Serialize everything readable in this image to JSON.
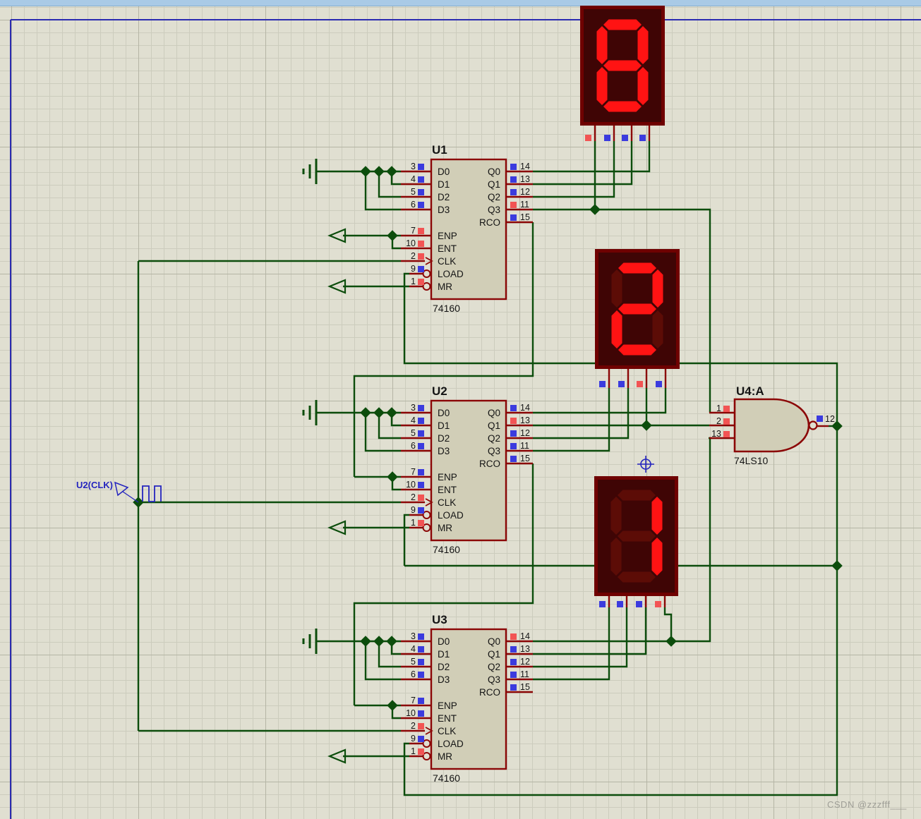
{
  "window": {
    "watermark": "CSDN @zzzfff___"
  },
  "colors": {
    "wire": "#0C4D0C",
    "pin": "#8B0606",
    "chip_fill": "#D1CEB7",
    "chip_border": "#8B0606",
    "state_red": "#F25454",
    "state_blue": "#3B3BDE",
    "ink_blue": "#2525BE",
    "display_bg": "#3F0505",
    "display_border": "#6F0101",
    "segment_lit": "#FF1313",
    "segment_unlit": "#5C0C06",
    "text": "#141414",
    "sheet_border": "#2B2BB0"
  },
  "clock_source": {
    "label": "U2(CLK)"
  },
  "chips": [
    {
      "ref": "U1",
      "part": "74160",
      "left_pins": [
        {
          "num": "3",
          "label": "D0",
          "state": "blue"
        },
        {
          "num": "4",
          "label": "D1",
          "state": "blue"
        },
        {
          "num": "5",
          "label": "D2",
          "state": "blue"
        },
        {
          "num": "6",
          "label": "D3",
          "state": "blue"
        },
        {
          "num": "7",
          "label": "ENP",
          "state": "red"
        },
        {
          "num": "10",
          "label": "ENT",
          "state": "red"
        },
        {
          "num": "2",
          "label": "CLK",
          "state": "red",
          "clock": true
        },
        {
          "num": "9",
          "label": "LOAD",
          "state": "blue",
          "bubble": true
        },
        {
          "num": "1",
          "label": "MR",
          "state": "red",
          "bubble": true
        }
      ],
      "right_pins": [
        {
          "num": "14",
          "label": "Q0",
          "state": "blue"
        },
        {
          "num": "13",
          "label": "Q1",
          "state": "blue"
        },
        {
          "num": "12",
          "label": "Q2",
          "state": "blue"
        },
        {
          "num": "11",
          "label": "Q3",
          "state": "red"
        },
        {
          "num": "15",
          "label": "RCO",
          "state": "blue"
        }
      ]
    },
    {
      "ref": "U2",
      "part": "74160",
      "left_pins": [
        {
          "num": "3",
          "label": "D0",
          "state": "blue"
        },
        {
          "num": "4",
          "label": "D1",
          "state": "blue"
        },
        {
          "num": "5",
          "label": "D2",
          "state": "blue"
        },
        {
          "num": "6",
          "label": "D3",
          "state": "blue"
        },
        {
          "num": "7",
          "label": "ENP",
          "state": "blue"
        },
        {
          "num": "10",
          "label": "ENT",
          "state": "blue"
        },
        {
          "num": "2",
          "label": "CLK",
          "state": "red",
          "clock": true
        },
        {
          "num": "9",
          "label": "LOAD",
          "state": "blue",
          "bubble": true
        },
        {
          "num": "1",
          "label": "MR",
          "state": "red",
          "bubble": true
        }
      ],
      "right_pins": [
        {
          "num": "14",
          "label": "Q0",
          "state": "blue"
        },
        {
          "num": "13",
          "label": "Q1",
          "state": "red"
        },
        {
          "num": "12",
          "label": "Q2",
          "state": "blue"
        },
        {
          "num": "11",
          "label": "Q3",
          "state": "blue"
        },
        {
          "num": "15",
          "label": "RCO",
          "state": "blue"
        }
      ]
    },
    {
      "ref": "U3",
      "part": "74160",
      "left_pins": [
        {
          "num": "3",
          "label": "D0",
          "state": "blue"
        },
        {
          "num": "4",
          "label": "D1",
          "state": "blue"
        },
        {
          "num": "5",
          "label": "D2",
          "state": "blue"
        },
        {
          "num": "6",
          "label": "D3",
          "state": "blue"
        },
        {
          "num": "7",
          "label": "ENP",
          "state": "blue"
        },
        {
          "num": "10",
          "label": "ENT",
          "state": "blue"
        },
        {
          "num": "2",
          "label": "CLK",
          "state": "red",
          "clock": true
        },
        {
          "num": "9",
          "label": "LOAD",
          "state": "blue",
          "bubble": true
        },
        {
          "num": "1",
          "label": "MR",
          "state": "red",
          "bubble": true
        }
      ],
      "right_pins": [
        {
          "num": "14",
          "label": "Q0",
          "state": "red"
        },
        {
          "num": "13",
          "label": "Q1",
          "state": "blue"
        },
        {
          "num": "12",
          "label": "Q2",
          "state": "blue"
        },
        {
          "num": "11",
          "label": "Q3",
          "state": "blue"
        },
        {
          "num": "15",
          "label": "RCO",
          "state": "blue"
        }
      ]
    }
  ],
  "displays": [
    {
      "name": "seven-seg-display-1",
      "digit": "8",
      "segments": [
        "a",
        "b",
        "c",
        "d",
        "e",
        "f",
        "g"
      ],
      "pin_states": [
        "red",
        "blue",
        "blue",
        "blue"
      ]
    },
    {
      "name": "seven-seg-display-2",
      "digit": "2",
      "segments": [
        "a",
        "b",
        "g",
        "e",
        "d"
      ],
      "pin_states": [
        "blue",
        "blue",
        "red",
        "blue"
      ]
    },
    {
      "name": "seven-seg-display-3",
      "digit": "1",
      "segments": [
        "b",
        "c"
      ],
      "pin_states": [
        "blue",
        "blue",
        "blue",
        "red"
      ]
    }
  ],
  "gate": {
    "ref": "U4:A",
    "part": "74LS10",
    "inputs": [
      {
        "num": "1",
        "state": "red"
      },
      {
        "num": "2",
        "state": "red"
      },
      {
        "num": "13",
        "state": "red"
      }
    ],
    "output": {
      "num": "12",
      "state": "blue"
    }
  }
}
